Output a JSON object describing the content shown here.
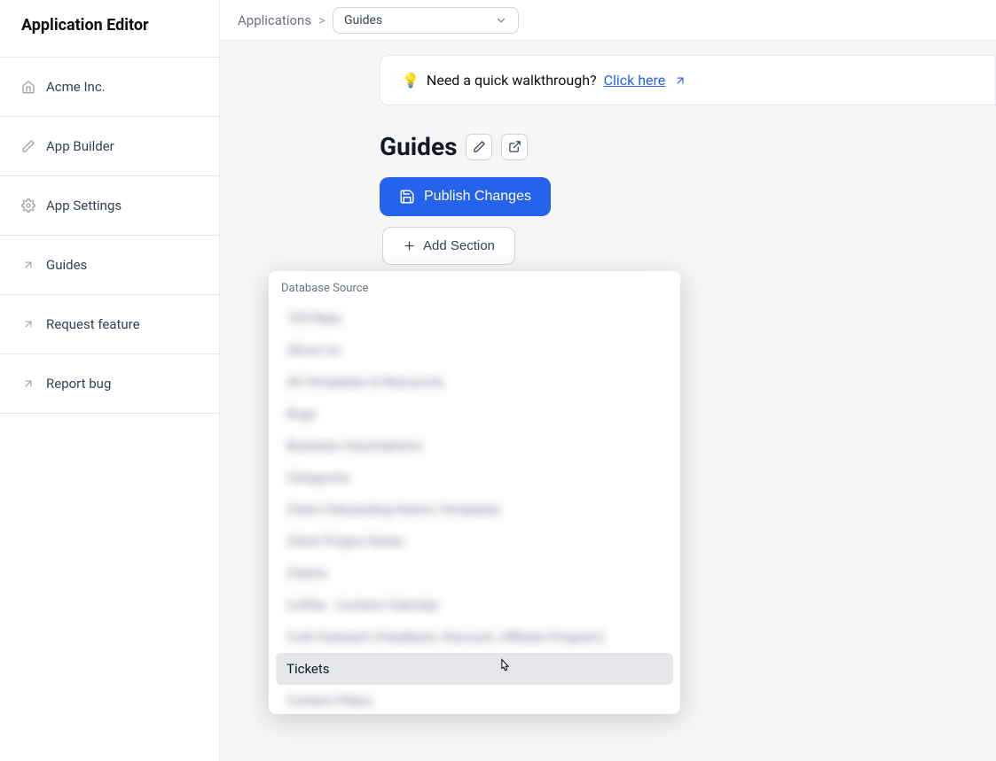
{
  "sidebar": {
    "title": "Application Editor",
    "items": [
      {
        "label": "Acme Inc.",
        "icon": "home-icon"
      },
      {
        "label": "App Builder",
        "icon": "pencil-icon"
      },
      {
        "label": "App Settings",
        "icon": "gear-icon"
      },
      {
        "label": "Guides",
        "icon": "arrow-up-right-icon"
      },
      {
        "label": "Request feature",
        "icon": "arrow-up-right-icon"
      },
      {
        "label": "Report bug",
        "icon": "arrow-up-right-icon"
      }
    ]
  },
  "breadcrumb": {
    "root": "Applications",
    "separator": ">",
    "selected": "Guides"
  },
  "banner": {
    "emoji": "💡",
    "text": "Need a quick walkthrough?",
    "link_text": "Click here"
  },
  "page": {
    "title": "Guides"
  },
  "buttons": {
    "publish": "Publish Changes",
    "add_section": "Add Section"
  },
  "dropdown": {
    "header": "Database Source",
    "items": [
      {
        "label": "100 Reps",
        "blurred": true
      },
      {
        "label": "About Us",
        "blurred": true
      },
      {
        "label": "All Templates & Resources",
        "blurred": true
      },
      {
        "label": "Bugs",
        "blurred": true
      },
      {
        "label": "Business Assumptions",
        "blurred": true
      },
      {
        "label": "Categories",
        "blurred": true
      },
      {
        "label": "Client Onboarding Notion Templates",
        "blurred": true
      },
      {
        "label": "Client Project Notes",
        "blurred": true
      },
      {
        "label": "Clients",
        "blurred": true
      },
      {
        "label": "Coffee - Content Calendar",
        "blurred": true
      },
      {
        "label": "Cold Outreach (Feedback, Discount, Affiliate Program)",
        "blurred": true
      },
      {
        "label": "Tickets",
        "blurred": false,
        "highlight": true
      },
      {
        "label": "Content Pillars",
        "blurred": true
      }
    ]
  }
}
